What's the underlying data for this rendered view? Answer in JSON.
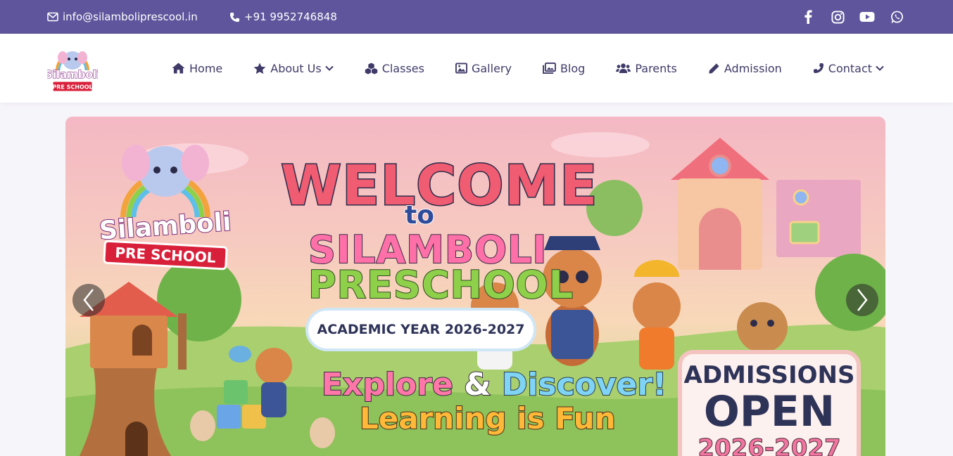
{
  "topbar": {
    "email": "info@silamboliprescool.in",
    "phone": "+91 9952746848",
    "social_icons": [
      "facebook-icon",
      "instagram-icon",
      "youtube-icon",
      "whatsapp-icon"
    ]
  },
  "logo": {
    "brand": "Silamboli",
    "sub": "PRE SCHOOL"
  },
  "nav": {
    "items": [
      {
        "label": "Home",
        "icon": "home-icon"
      },
      {
        "label": "About Us",
        "icon": "star-icon",
        "dropdown": true
      },
      {
        "label": "Classes",
        "icon": "cubes-icon"
      },
      {
        "label": "Gallery",
        "icon": "image-icon"
      },
      {
        "label": "Blog",
        "icon": "images-icon"
      },
      {
        "label": "Parents",
        "icon": "users-icon"
      },
      {
        "label": "Admission",
        "icon": "pencil-icon"
      },
      {
        "label": "Contact",
        "icon": "phone-icon",
        "dropdown": true
      }
    ]
  },
  "banner": {
    "welcome": "WELCOME",
    "to": "to",
    "school_line1": "SILAMBOLI",
    "school_line2": "PRESCHOOL",
    "academic_year": "ACADEMIC YEAR 2026-2027",
    "explore_part1": "Explore",
    "explore_amp": "&",
    "explore_part2": "Discover!",
    "learning": "Learning is Fun",
    "admissions": "ADMISSIONS",
    "open": "OPEN",
    "year": "2026-2027",
    "logo_name": "Silamboli",
    "logo_sub": "PRE SCHOOL"
  },
  "colors": {
    "topbar": "#5e559c",
    "nav_text": "#3f3a68"
  }
}
